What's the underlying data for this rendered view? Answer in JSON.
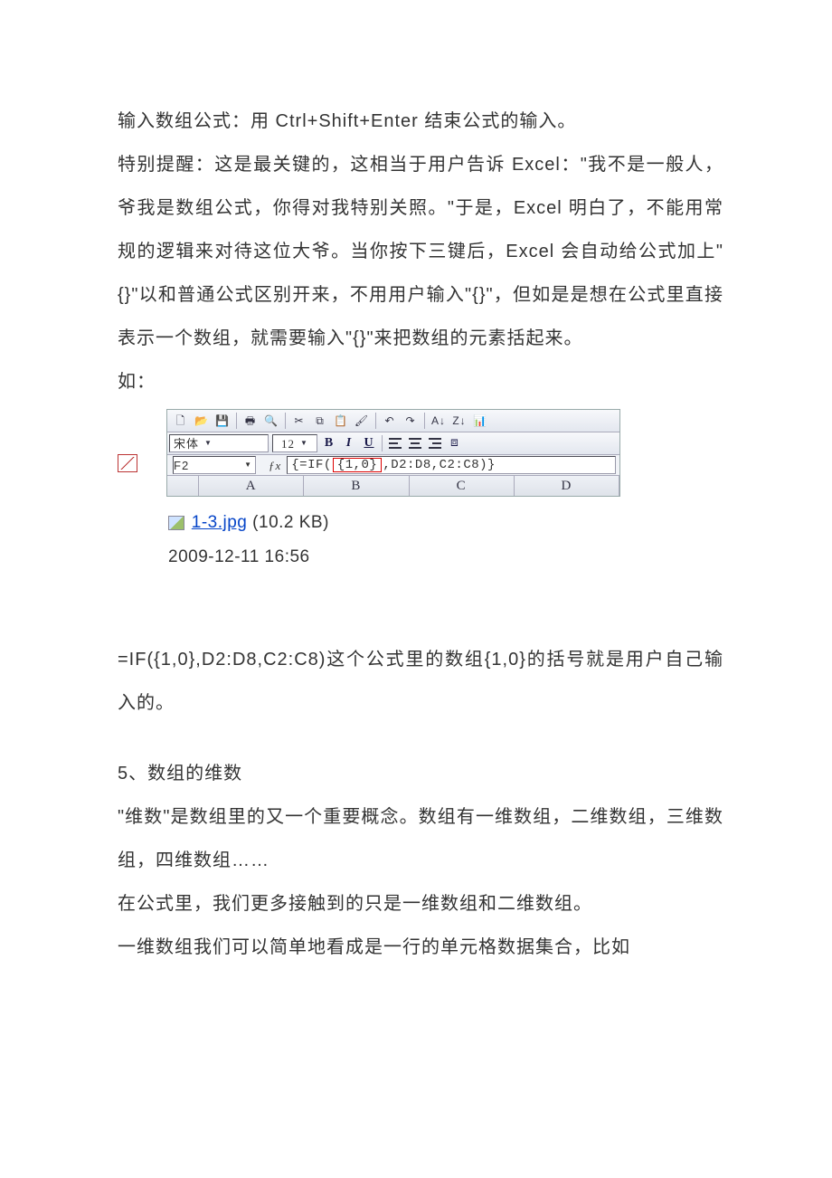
{
  "p1": "输入数组公式：用 Ctrl+Shift+Enter 结束公式的输入。",
  "p2": "特别提醒：这是最关键的，这相当于用户告诉 Excel：\"我不是一般人，爷我是数组公式，你得对我特别关照。\"于是，Excel 明白了，不能用常规的逻辑来对待这位大爷。当你按下三键后，Excel 会自动给公式加上\"{}\"以和普通公式区别开来，不用用户输入\"{}\"，但如是是想在公式里直接表示一个数组，就需要输入\"{}\"来把数组的元素括起来。",
  "p3": "如：",
  "excel": {
    "font_name": "宋体",
    "font_size": "12",
    "namebox": "F2",
    "formula_pre": "{=IF(",
    "formula_boxed": "{1,0}",
    "formula_post": ",D2:D8,C2:C8)}",
    "cols": [
      "A",
      "B",
      "C",
      "D"
    ]
  },
  "file": {
    "name": "1-3.jpg",
    "size": "(10.2 KB)",
    "time": "2009-12-11 16:56"
  },
  "p4": "=IF({1,0},D2:D8,C2:C8)这个公式里的数组{1,0}的括号就是用户自己输入的。",
  "p5": "5、数组的维数",
  "p6": "\"维数\"是数组里的又一个重要概念。数组有一维数组，二维数组，三维数组，四维数组……",
  "p7": "在公式里，我们更多接触到的只是一维数组和二维数组。",
  "p8": "一维数组我们可以简单地看成是一行的单元格数据集合，比如"
}
